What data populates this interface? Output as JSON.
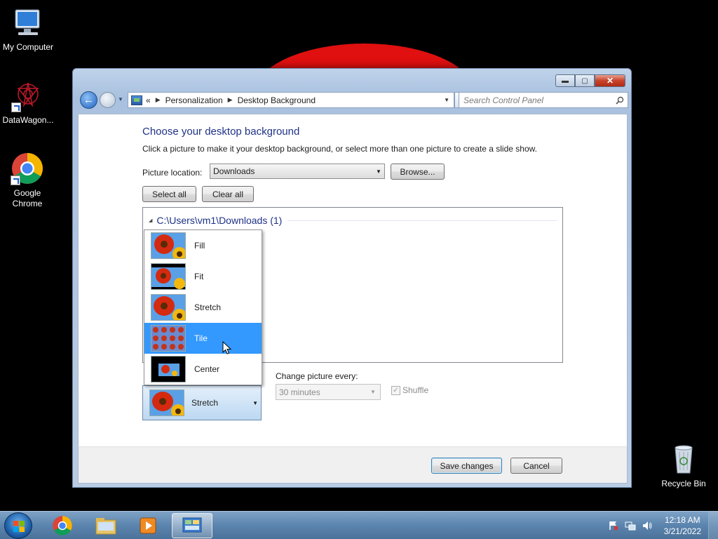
{
  "desktop": {
    "icons": [
      {
        "label": "My Computer"
      },
      {
        "label": "DataWagon..."
      },
      {
        "label": "Google Chrome"
      },
      {
        "label": "Recycle Bin"
      }
    ]
  },
  "window": {
    "controls": {
      "minimize": "▬",
      "maximize": "▢",
      "close": "✕"
    },
    "breadcrumb": {
      "prefix": "«",
      "items": [
        "Personalization",
        "Desktop Background"
      ]
    },
    "search_placeholder": "Search Control Panel",
    "title": "Choose your desktop background",
    "description": "Click a picture to make it your desktop background, or select more than one picture to create a slide show.",
    "picture_location": {
      "label": "Picture location:",
      "value": "Downloads",
      "browse": "Browse..."
    },
    "select_all": "Select all",
    "clear_all": "Clear all",
    "group_header": "C:\\Users\\vm1\\Downloads (1)",
    "position_menu": {
      "items": [
        {
          "label": "Fill",
          "selected": false
        },
        {
          "label": "Fit",
          "selected": false
        },
        {
          "label": "Stretch",
          "selected": false
        },
        {
          "label": "Tile",
          "selected": true
        },
        {
          "label": "Center",
          "selected": false
        }
      ]
    },
    "picture_position": {
      "value": "Stretch"
    },
    "change_picture": {
      "label": "Change picture every:",
      "value": "30 minutes"
    },
    "shuffle": {
      "label": "Shuffle",
      "checked": true
    },
    "footer": {
      "save": "Save changes",
      "cancel": "Cancel"
    }
  },
  "taskbar": {
    "items": [
      "start-button",
      "chrome",
      "explorer",
      "media-player",
      "control-panel"
    ],
    "active": "control-panel",
    "clock": {
      "time": "12:18 AM",
      "date": "3/21/2022"
    }
  },
  "colors": {
    "accent": "#3399ff",
    "title": "#1e3287",
    "desktop": "#000000"
  }
}
